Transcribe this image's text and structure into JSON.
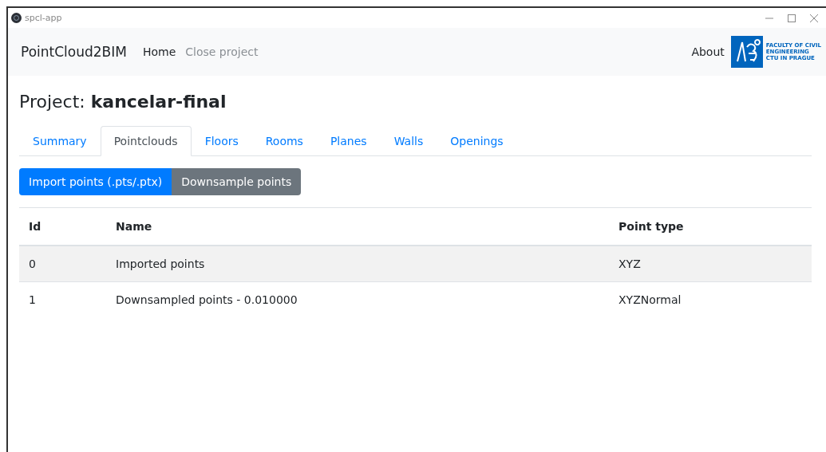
{
  "window": {
    "title": "spcl-app"
  },
  "navbar": {
    "brand": "PointCloud2BIM",
    "links": [
      {
        "label": "Home",
        "disabled": false
      },
      {
        "label": "Close project",
        "disabled": true
      }
    ],
    "about": "About",
    "logo_lines": [
      "FACULTY OF CIVIL",
      "ENGINEERING",
      "CTU IN PRAGUE"
    ]
  },
  "project": {
    "label": "Project:",
    "name": "kancelar-final"
  },
  "tabs": [
    {
      "label": "Summary",
      "selected": false
    },
    {
      "label": "Pointclouds",
      "selected": true
    },
    {
      "label": "Floors",
      "selected": false
    },
    {
      "label": "Rooms",
      "selected": false
    },
    {
      "label": "Planes",
      "selected": false
    },
    {
      "label": "Walls",
      "selected": false
    },
    {
      "label": "Openings",
      "selected": false
    }
  ],
  "buttons": [
    {
      "label": "Import points (.pts/.ptx)",
      "kind": "primary"
    },
    {
      "label": "Downsample points",
      "kind": "secondary"
    }
  ],
  "table": {
    "columns": [
      "Id",
      "Name",
      "Point type"
    ],
    "rows": [
      [
        "0",
        "Imported points",
        "XYZ"
      ],
      [
        "1",
        "Downsampled points - 0.010000",
        "XYZNormal"
      ]
    ]
  }
}
